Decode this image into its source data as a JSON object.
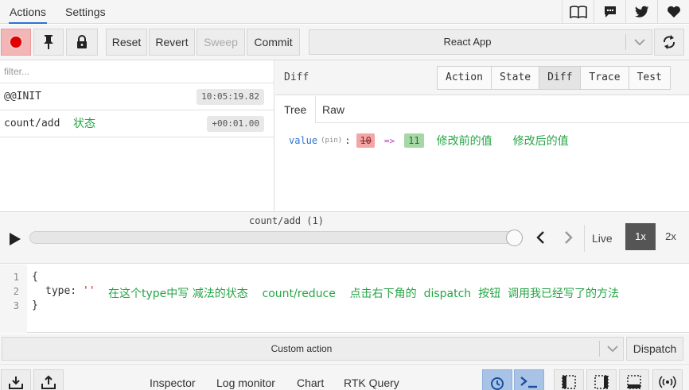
{
  "top_tabs": [
    {
      "label": "Actions",
      "active": true
    },
    {
      "label": "Settings",
      "active": false
    }
  ],
  "top_icons": [
    "book-icon",
    "chat-icon",
    "twitter-icon",
    "heart-icon"
  ],
  "toolbar": {
    "record_icon": "record-icon",
    "pin_icon": "pin-icon",
    "lock_icon": "lock-icon",
    "reset": "Reset",
    "revert": "Revert",
    "sweep": "Sweep",
    "commit": "Commit",
    "instance": "React App",
    "sync_icon": "sync-icon"
  },
  "action_list": {
    "filter_placeholder": "filter...",
    "items": [
      {
        "name": "@@INIT",
        "time": "10:05:19.82",
        "annotation": ""
      },
      {
        "name": "count/add",
        "time": "+00:01.00",
        "annotation": "状态"
      }
    ]
  },
  "monitor": {
    "title": "Diff",
    "tabs": [
      "Action",
      "State",
      "Diff",
      "Trace",
      "Test"
    ],
    "active_tab": "Diff",
    "subtabs": [
      "Tree",
      "Raw"
    ],
    "active_subtab": "Tree",
    "diff": {
      "key": "value",
      "pin": "(pin)",
      "old": "10",
      "arrow": "=>",
      "new": "11",
      "annotation_old": "修改前的值",
      "annotation_new": "修改后的值"
    }
  },
  "slider": {
    "label": "count/add  (1)",
    "progress": 1.0,
    "live": "Live",
    "speed_1x": "1x",
    "speed_2x": "2x",
    "selected_speed": "1x"
  },
  "editor": {
    "line_numbers": [
      "1",
      "2",
      "3"
    ],
    "line1": "{",
    "type_key": "type:",
    "type_value": "''",
    "line3": "}",
    "annotation": "在这个type中写 减法的状态    count/reduce    点击右下角的  dispatch  按钮  调用我已经写了的方法"
  },
  "custom_action": {
    "label": "Custom action",
    "dispatch": "Dispatch"
  },
  "bottom_bar": {
    "import_icon": "import-icon",
    "export_icon": "export-icon",
    "monitors": [
      "Inspector",
      "Log monitor",
      "Chart",
      "RTK Query"
    ],
    "right_icons": [
      "timer-icon",
      "terminal-icon",
      "dock-left-icon",
      "dock-right-icon",
      "dock-bottom-icon",
      "remote-icon"
    ]
  },
  "colors": {
    "record": "#e10000",
    "annotation": "#26a546",
    "diff_old_bg": "#f2a6a6",
    "diff_new_bg": "#a6d8a6",
    "active_speed": "#555555",
    "accent": "#2b73d4"
  }
}
